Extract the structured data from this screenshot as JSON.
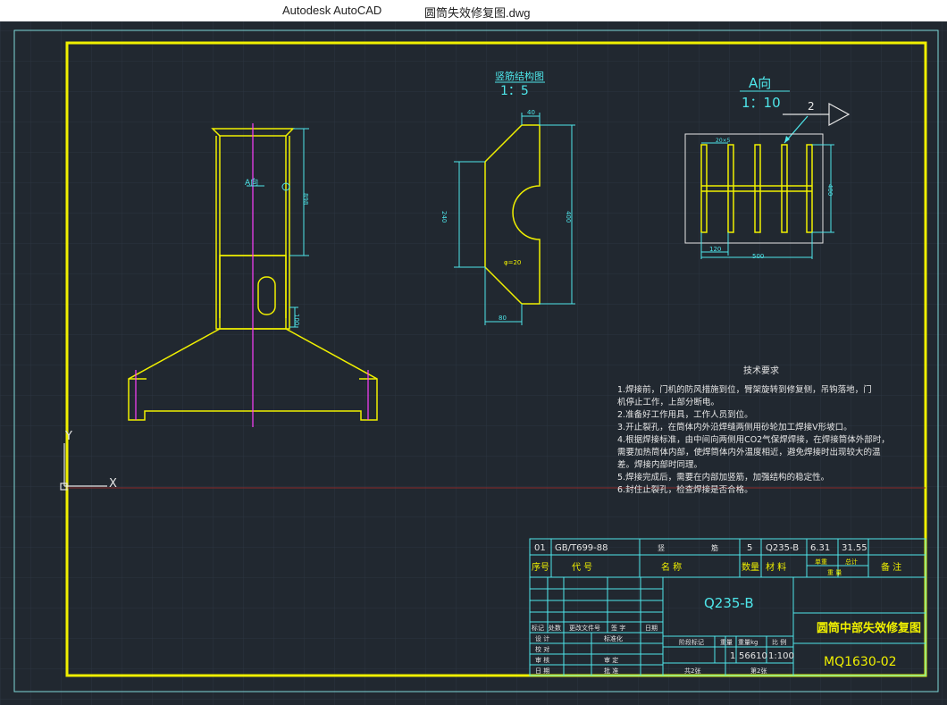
{
  "window": {
    "app_name": "Autodesk AutoCAD",
    "file_name": "圆筒失效修复图.dwg"
  },
  "colors": {
    "background": "#212830",
    "grid": "#2c3540",
    "frame_outer": "#7fd8d8",
    "frame_inner": "#f0f000",
    "cyan": "#4ee6ea",
    "yellow": "#f0f000",
    "magenta": "#ff40ff",
    "white": "#e6e6e6"
  },
  "drawing": {
    "main_view": {
      "view_label": "A向",
      "dims": {
        "top": "898",
        "lower": "100"
      }
    },
    "rib_detail": {
      "title": "竖筋结构图",
      "scale": "1：5",
      "dims": {
        "top": "40",
        "left": "240",
        "right": "400",
        "bottom": "80",
        "hole": "φ=20"
      }
    },
    "a_view": {
      "title": "A向",
      "scale": "1：10",
      "leader_number": "2",
      "dims": {
        "plate": "20×5",
        "height": "400",
        "pitch": "120",
        "width": "500"
      }
    },
    "tech_requirements": {
      "title": "技术要求",
      "lines": [
        "1.焊接前，门机的防风措施到位，臂架旋转到修复侧，吊钩落地，门",
        "机停止工作，上部分断电。",
        "2.准备好工作用具，工作人员到位。",
        "3.开止裂孔，在筒体内外沿焊缝两侧用砂轮加工焊接V形坡口。",
        "4.根据焊接标准，由中间向两侧用CO2气保焊焊接，在焊接筒体外部时，",
        "需要加热筒体内部，使焊筒体内外温度相近，避免焊接时出现较大的温",
        "差。焊接内部时同理。",
        "5.焊接完成后，需要在内部加竖筋，加强结构的稳定性。",
        "6.封住止裂孔，检查焊接是否合格。"
      ]
    },
    "ucs": {
      "x": "X",
      "y": "Y"
    },
    "title_block": {
      "parts_row": {
        "seq": "01",
        "code": "GB/T699-88",
        "name_a": "竖",
        "name_b": "筋",
        "qty": "5",
        "material": "Q235-B",
        "unit_weight": "6.31",
        "total_weight": "31.55"
      },
      "header": {
        "seq": "序号",
        "code": "代  号",
        "name": "名  称",
        "qty": "数量",
        "material": "材  料",
        "single": "单重",
        "total": "总计",
        "weight": "重  量",
        "remark": "备  注"
      },
      "material_center": "Q235-B",
      "drawing_title": "圆筒中部失效修复图",
      "drawing_number": "MQ1630-02",
      "rev_header": [
        "标记",
        "处数",
        "更改文件号",
        "签 字",
        "日期"
      ],
      "sign_rows": [
        {
          "label": "设  计",
          "label2": "标准化"
        },
        {
          "label": "校  对",
          "label2": ""
        },
        {
          "label": "审  核",
          "label2": "审  定"
        },
        {
          "label": "日  期",
          "label2": "批  准"
        }
      ],
      "stage": {
        "stage_label": "阶段标记",
        "weight_label": "重量",
        "weight_unit_label": "重量kg",
        "scale_label": "比 例",
        "count": "1",
        "weight": "56610",
        "scale": "1:100"
      },
      "sheets": {
        "total": "共2张",
        "current": "第2张"
      }
    }
  }
}
